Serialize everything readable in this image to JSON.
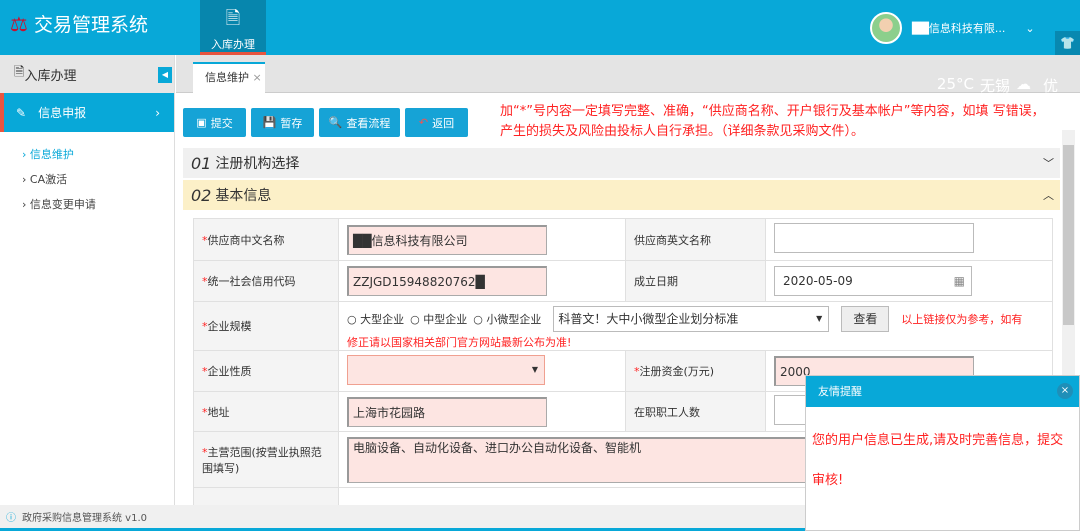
{
  "header": {
    "app_title": "交易管理系统",
    "nav_tab": "入库办理",
    "user_name": "██信息科技有限...",
    "weather": {
      "temp": "25°C",
      "city": "无锡",
      "quality": "优"
    }
  },
  "sidebar": {
    "title": "入库办理",
    "active": "信息申报",
    "items": [
      "信息维护",
      "CA激活",
      "信息变更申请"
    ]
  },
  "tabs": [
    {
      "label": "信息维护",
      "close": "×"
    }
  ],
  "toolbar": {
    "submit": "提交",
    "save": "暂存",
    "flow": "查看流程",
    "back": "返回"
  },
  "notice": "加“*”号内容一定填写完整、准确，“供应商名称、开户银行及基本帐户”等内容，如填 写错误，产生的损失及风险由投标人自行承担。（详细条款见采购文件）。",
  "sections": [
    {
      "num": "01",
      "title": "注册机构选择"
    },
    {
      "num": "02",
      "title": "基本信息"
    }
  ],
  "form": {
    "cn_name_label": "供应商中文名称",
    "cn_name": "██信息科技有限公司",
    "en_name_label": "供应商英文名称",
    "en_name": "",
    "credit_label": "统一社会信用代码",
    "credit": "ZZJGD15948820762█",
    "date_label": "成立日期",
    "date": "2020-05-09",
    "scale_label": "企业规模",
    "scale_options": [
      "大型企业",
      "中型企业",
      "小微型企业"
    ],
    "scale_link": "科普文！大中小微型企业划分标准",
    "view": "查看",
    "scale_note1": "以上链接仅为参考，如有",
    "scale_note2": "修正请以国家相关部门官方网站最新公布为准!",
    "nature_label": "企业性质",
    "nature": "",
    "capital_label": "注册资金(万元)",
    "capital": "2000",
    "addr_label": "地址",
    "addr": "上海市花园路",
    "staff_label": "在职职工人数",
    "staff": "",
    "scope_label": "主营范围(按营业执照范围填写)",
    "scope": "电脑设备、自动化设备、进口办公自动化设备、智能机"
  },
  "footer": "政府采购信息管理系统 v1.0",
  "popup": {
    "title": "友情提醒",
    "close": "×",
    "message": "您的用户信息已生成,请及时完善信息，提交审核!"
  }
}
